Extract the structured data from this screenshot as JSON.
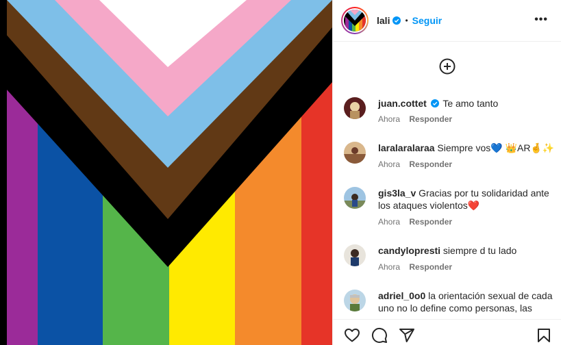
{
  "post": {
    "media_alt_icon": "progress-pride-flag",
    "flag_colors": {
      "white": "#ffffff",
      "pink": "#f5a8c8",
      "light_blue": "#7ebfe8",
      "brown": "#613915",
      "black": "#000000",
      "purple": "#9b2b99",
      "blue": "#0b52a5",
      "green": "#55b54a",
      "yellow": "#ffea00",
      "orange": "#f48a2c",
      "red": "#e63428"
    }
  },
  "header": {
    "username": "lali",
    "verified": true,
    "separator": "•",
    "follow_label": "Seguir",
    "more_label": "•••"
  },
  "comments": [
    {
      "user": "juan.cottet",
      "verified": true,
      "text": "Te amo tanto",
      "time": "Ahora",
      "reply": "Responder"
    },
    {
      "user": "laralaralaraa",
      "verified": false,
      "text": "Siempre vos💙 👑AR🤞✨",
      "time": "Ahora",
      "reply": "Responder"
    },
    {
      "user": "gis3la_v",
      "verified": false,
      "text": "Gracias por tu solidaridad ante los ataques violentos❤️",
      "time": "Ahora",
      "reply": "Responder"
    },
    {
      "user": "candylopresti",
      "verified": false,
      "text": "siempre d tu lado",
      "time": "Ahora",
      "reply": "Responder"
    },
    {
      "user": "adriel_0o0",
      "verified": false,
      "text": "la orientación sexual de cada uno no lo define como personas, las",
      "time": "",
      "reply": ""
    }
  ],
  "actions": {
    "like_icon": "heart-icon",
    "comment_icon": "comment-icon",
    "share_icon": "share-icon",
    "save_icon": "bookmark-icon"
  },
  "colors": {
    "link_blue": "#0095f6",
    "verified_blue": "#0095f6",
    "text": "#262626",
    "muted": "#737373"
  }
}
